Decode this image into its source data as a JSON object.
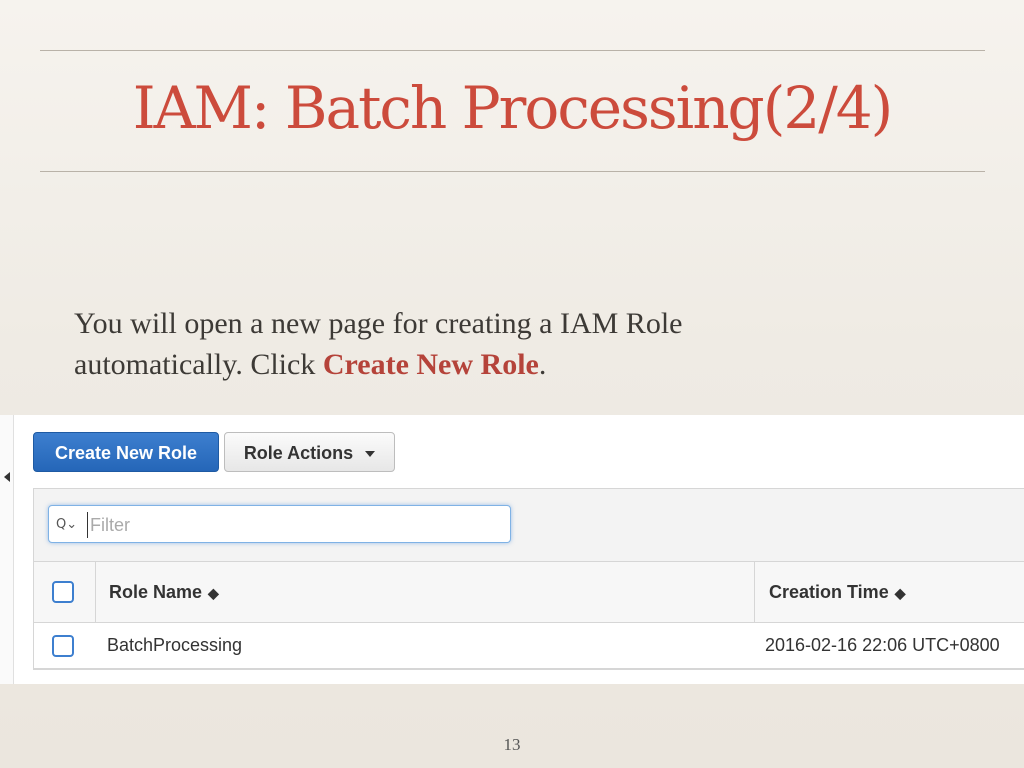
{
  "slide": {
    "title": "IAM: Batch Processing(2/4)",
    "body_line1": "You will open a new page for creating a IAM Role",
    "body_line2_prefix": "automatically. Click ",
    "body_highlight": "Create New Role",
    "body_line2_suffix": ".",
    "page_number": "13"
  },
  "toolbar": {
    "create_label": "Create New Role",
    "actions_label": "Role Actions"
  },
  "filter": {
    "icon": "search-icon",
    "placeholder": "Filter",
    "value": ""
  },
  "table": {
    "columns": [
      "Role Name",
      "Creation Time"
    ],
    "rows": [
      {
        "name": "BatchProcessing",
        "created": "2016-02-16 22:06 UTC+0800"
      }
    ]
  },
  "colors": {
    "title": "#cc4b3c",
    "highlight": "#b5433a",
    "primary_button": "#2566b8"
  }
}
